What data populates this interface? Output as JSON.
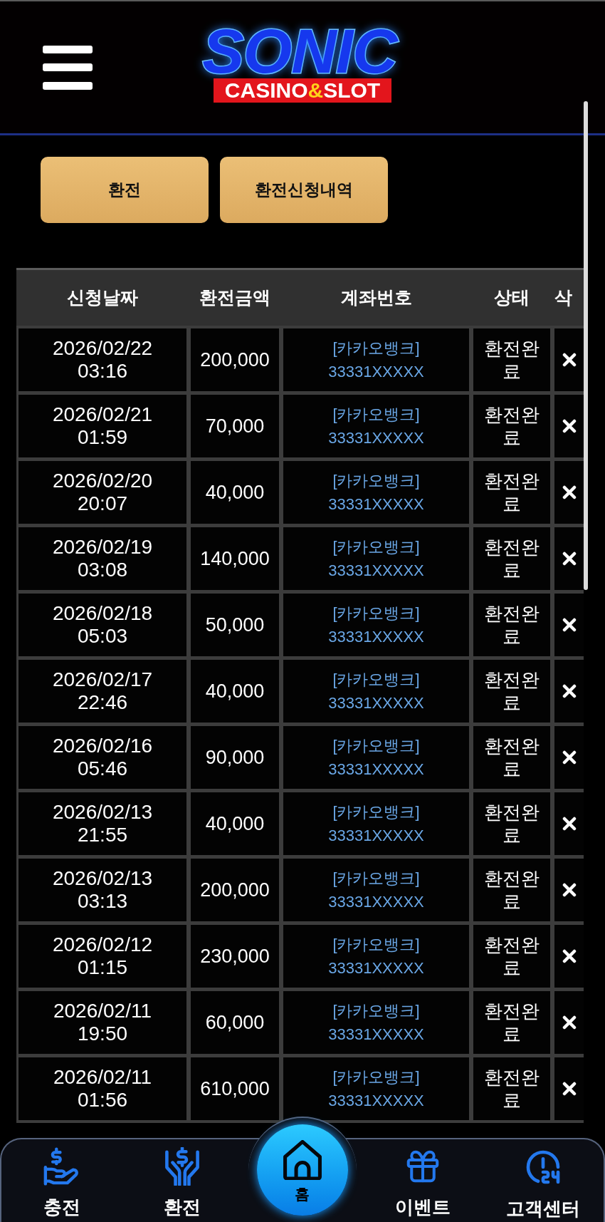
{
  "header": {
    "logo": {
      "wordmark": "SONIC",
      "banner": {
        "before": "CASINO",
        "mark": "&",
        "after": "SLOT"
      }
    }
  },
  "buttons": [
    "환전",
    "환전신청내역"
  ],
  "table": {
    "columns": [
      "신청날짜",
      "환전금액",
      "계좌번호",
      "상태",
      "삭"
    ],
    "rows": [
      {
        "date": "2026/02/22",
        "time": "03:16",
        "amount": "200,000",
        "bank": "[카카오뱅크]",
        "account": "33331XXXXX",
        "status": "환전완료"
      },
      {
        "date": "2026/02/21",
        "time": "01:59",
        "amount": "70,000",
        "bank": "[카카오뱅크]",
        "account": "33331XXXXX",
        "status": "환전완료"
      },
      {
        "date": "2026/02/20",
        "time": "20:07",
        "amount": "40,000",
        "bank": "[카카오뱅크]",
        "account": "33331XXXXX",
        "status": "환전완료"
      },
      {
        "date": "2026/02/19",
        "time": "03:08",
        "amount": "140,000",
        "bank": "[카카오뱅크]",
        "account": "33331XXXXX",
        "status": "환전완료"
      },
      {
        "date": "2026/02/18",
        "time": "05:03",
        "amount": "50,000",
        "bank": "[카카오뱅크]",
        "account": "33331XXXXX",
        "status": "환전완료"
      },
      {
        "date": "2026/02/17",
        "time": "22:46",
        "amount": "40,000",
        "bank": "[카카오뱅크]",
        "account": "33331XXXXX",
        "status": "환전완료"
      },
      {
        "date": "2026/02/16",
        "time": "05:46",
        "amount": "90,000",
        "bank": "[카카오뱅크]",
        "account": "33331XXXXX",
        "status": "환전완료"
      },
      {
        "date": "2026/02/13",
        "time": "21:55",
        "amount": "40,000",
        "bank": "[카카오뱅크]",
        "account": "33331XXXXX",
        "status": "환전완료"
      },
      {
        "date": "2026/02/13",
        "time": "03:13",
        "amount": "200,000",
        "bank": "[카카오뱅크]",
        "account": "33331XXXXX",
        "status": "환전완료"
      },
      {
        "date": "2026/02/12",
        "time": "01:15",
        "amount": "230,000",
        "bank": "[카카오뱅크]",
        "account": "33331XXXXX",
        "status": "환전완료"
      },
      {
        "date": "2026/02/11",
        "time": "19:50",
        "amount": "60,000",
        "bank": "[카카오뱅크]",
        "account": "33331XXXXX",
        "status": "환전완료"
      },
      {
        "date": "2026/02/11",
        "time": "01:56",
        "amount": "610,000",
        "bank": "[카카오뱅크]",
        "account": "33331XXXXX",
        "status": "환전완료"
      }
    ]
  },
  "bottom_nav": [
    {
      "label": "충전",
      "kind": "side"
    },
    {
      "label": "환전",
      "kind": "side"
    },
    {
      "label": "홈",
      "kind": "center"
    },
    {
      "label": "이벤트",
      "kind": "side"
    },
    {
      "label": "고객센터",
      "kind": "side"
    }
  ]
}
